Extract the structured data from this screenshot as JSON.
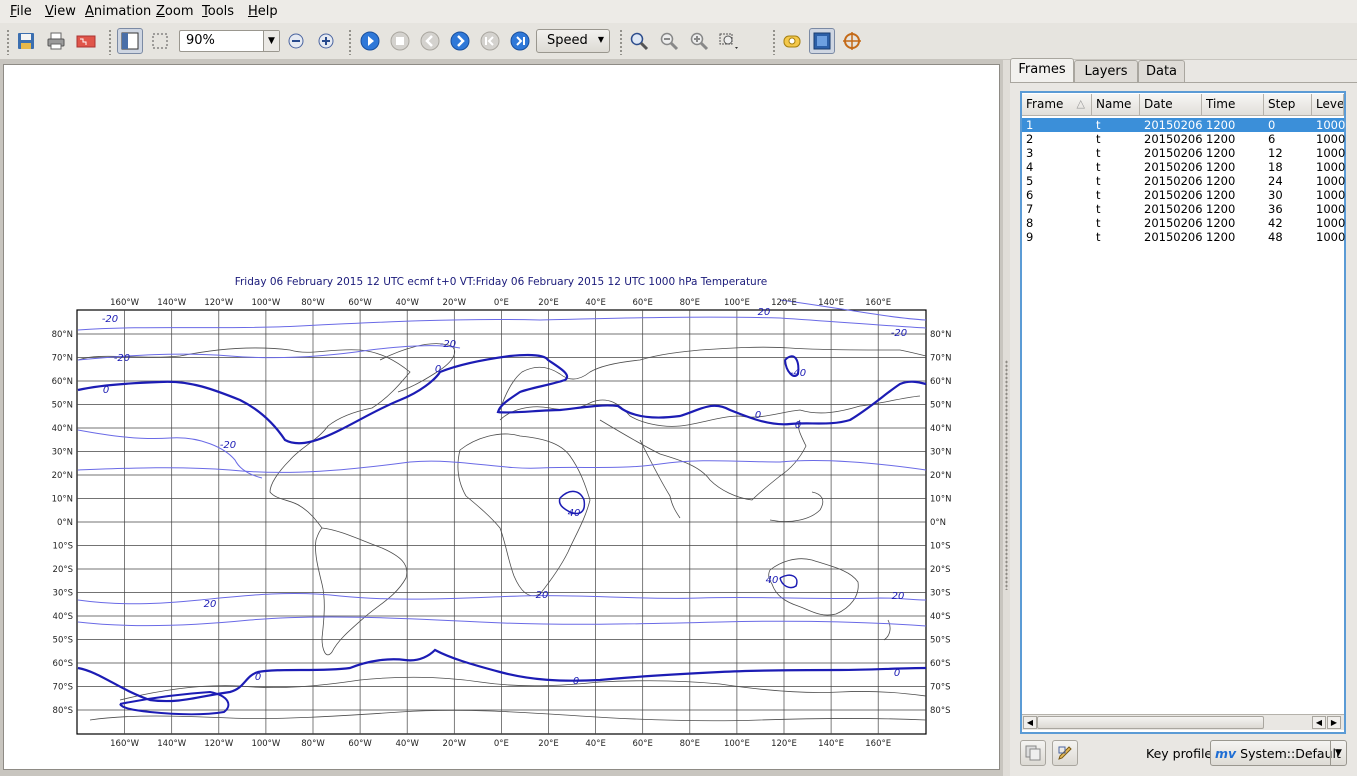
{
  "menu": {
    "file": {
      "hot": "F",
      "rest": "ile"
    },
    "view": {
      "hot": "V",
      "rest": "iew"
    },
    "animation": {
      "hot": "A",
      "rest": "nimation"
    },
    "zoom": {
      "hot": "Z",
      "rest": "oom"
    },
    "tools": {
      "hot": "T",
      "rest": "ools"
    },
    "help": {
      "hot": "H",
      "rest": "elp"
    }
  },
  "toolbar": {
    "zoom_value": "90%",
    "speed_label": "Speed"
  },
  "map": {
    "title": "Friday 06 February 2015 12 UTC ecmf t+0 VT:Friday 06 February 2015 12 UTC 1000 hPa  Temperature",
    "lon_labels": [
      "160°W",
      "140°W",
      "120°W",
      "100°W",
      "80°W",
      "60°W",
      "40°W",
      "20°W",
      "0°E",
      "20°E",
      "40°E",
      "60°E",
      "80°E",
      "100°E",
      "120°E",
      "140°E",
      "160°E"
    ],
    "lat_labels": [
      "80°N",
      "70°N",
      "60°N",
      "50°N",
      "40°N",
      "30°N",
      "20°N",
      "10°N",
      "0°N",
      "10°S",
      "20°S",
      "30°S",
      "40°S",
      "50°S",
      "60°S",
      "70°S",
      "80°S"
    ],
    "contour_labels": [
      "-20",
      "-20",
      "-20",
      "-20",
      "0",
      "0",
      "0",
      "0",
      "0",
      "0",
      "0",
      "-40",
      "20",
      "20",
      "20",
      "20",
      "40",
      "40",
      "-20"
    ],
    "colors": {
      "contour": "#1c1cb4",
      "contour_light": "#6a6ae6",
      "coast": "#555555",
      "title": "#1a1a7a"
    }
  },
  "panel": {
    "tabs": [
      "Frames",
      "Layers",
      "Data"
    ],
    "active_tab": "Frames",
    "columns": [
      "Frame",
      "Name",
      "Date",
      "Time",
      "Step",
      "Level"
    ],
    "rows": [
      [
        "1",
        "t",
        "20150206",
        "1200",
        "0",
        "1000"
      ],
      [
        "2",
        "t",
        "20150206",
        "1200",
        "6",
        "1000"
      ],
      [
        "3",
        "t",
        "20150206",
        "1200",
        "12",
        "1000"
      ],
      [
        "4",
        "t",
        "20150206",
        "1200",
        "18",
        "1000"
      ],
      [
        "5",
        "t",
        "20150206",
        "1200",
        "24",
        "1000"
      ],
      [
        "6",
        "t",
        "20150206",
        "1200",
        "30",
        "1000"
      ],
      [
        "7",
        "t",
        "20150206",
        "1200",
        "36",
        "1000"
      ],
      [
        "8",
        "t",
        "20150206",
        "1200",
        "42",
        "1000"
      ],
      [
        "9",
        "t",
        "20150206",
        "1200",
        "48",
        "1000"
      ]
    ],
    "key_profile_label": "Key profile:",
    "key_profile_value": "System::Default",
    "key_profile_logo": "mv"
  }
}
